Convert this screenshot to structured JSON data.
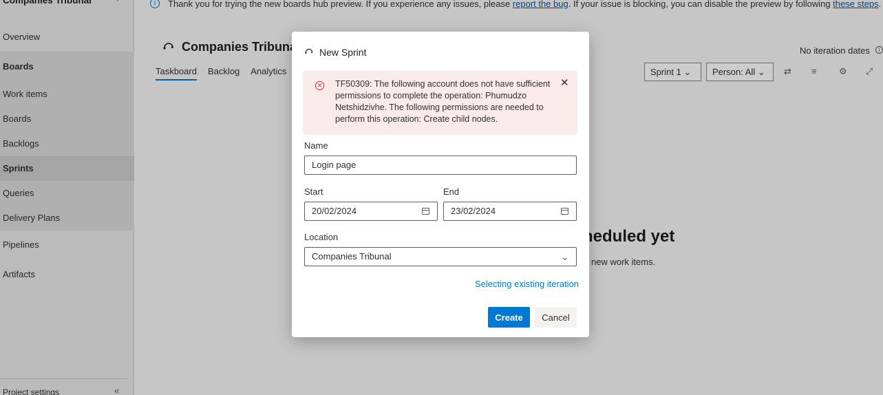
{
  "sidebar": {
    "project_name": "Companies Tribunal",
    "items": [
      {
        "label": "Overview"
      },
      {
        "label": "Boards"
      },
      {
        "label": "Work items"
      },
      {
        "label": "Boards"
      },
      {
        "label": "Backlogs"
      },
      {
        "label": "Sprints"
      },
      {
        "label": "Queries"
      },
      {
        "label": "Delivery Plans"
      },
      {
        "label": "Pipelines"
      },
      {
        "label": "Artifacts"
      }
    ],
    "footer_label": "Project settings"
  },
  "banner": {
    "text_before": "Thank you for trying the new boards hub preview. If you experience any issues, please ",
    "link1": "report the bug",
    "text_middle": ". If your issue is blocking, you can disable the preview by following ",
    "link2": "these steps",
    "text_after": "."
  },
  "board": {
    "title": "Companies Tribunal",
    "tabs": [
      {
        "label": "Taskboard"
      },
      {
        "label": "Backlog"
      },
      {
        "label": "Analytics"
      }
    ],
    "iteration_dates": "No iteration dates",
    "sprint_filter": "Sprint 1",
    "person_filter": "Person: All",
    "empty_title": "No iterations scheduled yet",
    "empty_title_visible": "heduled yet",
    "empty_sub_visible": "new work items."
  },
  "dialog": {
    "title": "New Sprint",
    "error_message": "TF50309: The following account does not have sufficient permissions to complete the operation: Phumudzo Netshidzivhe. The following permissions are needed to perform this operation: Create child nodes.",
    "name_label": "Name",
    "name_value": "Login page",
    "start_label": "Start",
    "start_value": "20/02/2024",
    "end_label": "End",
    "end_value": "23/02/2024",
    "location_label": "Location",
    "location_value": "Companies Tribunal",
    "existing_link": "Selecting existing iteration",
    "create_label": "Create",
    "cancel_label": "Cancel"
  },
  "colors": {
    "accent": "#0078d4",
    "error_bg": "#fbeaea",
    "error_icon": "#d13438"
  }
}
